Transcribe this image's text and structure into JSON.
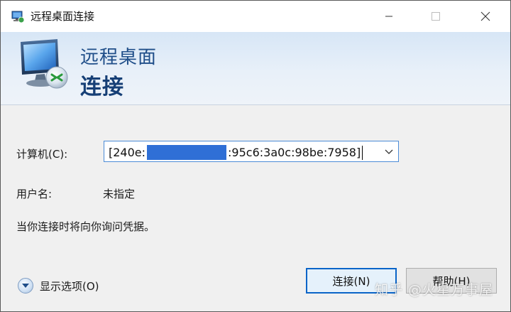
{
  "window": {
    "title": "远程桌面连接",
    "controls": {
      "minimize_icon": "minimize-icon",
      "maximize_icon": "maximize-icon",
      "close_icon": "close-icon"
    }
  },
  "banner": {
    "line1": "远程桌面",
    "line2": "连接",
    "icon": "remote-desktop-monitor-icon"
  },
  "form": {
    "computer_label": "计算机(C):",
    "computer_value_prefix": "[240e:",
    "computer_value_suffix": ":95c6:3a0c:98be:7958]",
    "computer_value_redacted": true,
    "username_label": "用户名:",
    "username_value": "未指定",
    "info_text": "当你连接时将向你询问凭据。"
  },
  "footer": {
    "options_label": "显示选项(O)",
    "connect_label": "连接(N)",
    "help_label": "帮助(H)"
  },
  "watermark": "知乎 @火星万事屋",
  "colors": {
    "accent": "#0a64c8",
    "banner_title": "#1f4e89",
    "redaction": "#2f6fd6"
  }
}
